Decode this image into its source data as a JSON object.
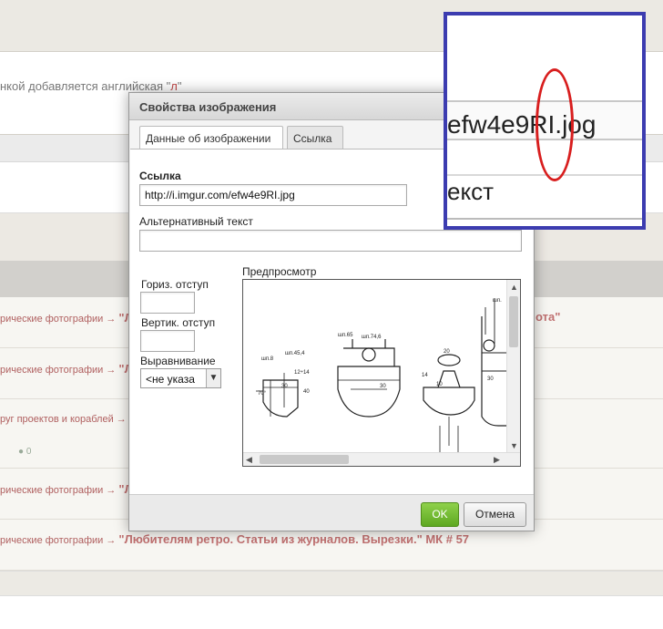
{
  "background": {
    "editor_text_pre": "нкой добавляется английская \"",
    "editor_text_hl": "л",
    "editor_text_post": "\"",
    "rows": [
      {
        "prefix": "рические фотографии →",
        "title": "\"Л",
        "tail": "ота\""
      },
      {
        "prefix": "рические фотографии →",
        "title": "\"Л",
        "tail": ""
      },
      {
        "prefix": "руг проектов и кораблей →",
        "title": "",
        "tail": ""
      },
      {
        "prefix": "рические фотографии →",
        "title": "\"Л",
        "tail": ""
      },
      {
        "prefix": "рические фотографии →",
        "title": "\"Любителям ретро. Статьи из журналов. Вырезки.\" МК # 57",
        "tail": ""
      }
    ],
    "counter": "0"
  },
  "dialog": {
    "title": "Свойства изображения",
    "tabs": [
      "Данные об изображении",
      "Ссылка"
    ],
    "url_label": "Ссылка",
    "url_value": "http://i.imgur.com/efw4e9RI.jpg",
    "alt_label": "Альтернативный текст",
    "alt_value": "",
    "hspace_label": "Гориз. отступ",
    "hspace_value": "",
    "vspace_label": "Вертик. отступ",
    "vspace_value": "",
    "align_label": "Выравнивание",
    "align_value": "<не указа",
    "preview_label": "Предпросмотр",
    "drawing_labels": {
      "a": "шп.8",
      "b": "шп.45,4",
      "c": "шп.65",
      "d": "шп.74,6",
      "e": "12÷14",
      "f": "30",
      "g": "40",
      "h": "70°",
      "i": "14",
      "j": "10",
      "k": "20",
      "l": "30",
      "m": "шп.",
      "n": "30"
    },
    "ok_label": "OK",
    "cancel_label": "Отмена"
  },
  "zoom": {
    "text1": "efw4e9RI.jog",
    "text2": "екст",
    "frame_color": "#3c3cb0",
    "marker_color": "#d81e1e"
  }
}
